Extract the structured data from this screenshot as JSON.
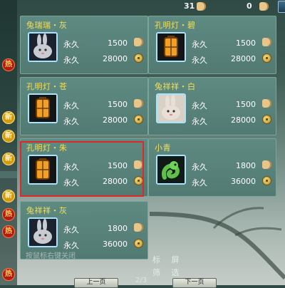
{
  "topbar": {
    "count_left": "31",
    "count_right": "0"
  },
  "sidebar_badges": [
    {
      "label": "热",
      "type": "hot"
    },
    {
      "label": "新",
      "type": "new"
    },
    {
      "label": "新",
      "type": "new"
    },
    {
      "label": "新",
      "type": "new"
    },
    {
      "label": "新",
      "type": "new"
    },
    {
      "label": "热",
      "type": "hot"
    },
    {
      "label": "热",
      "type": "hot"
    },
    {
      "label": "热",
      "type": "hot"
    }
  ],
  "items": [
    {
      "name": "兔瑞瑞・灰",
      "icon": "gray-rabbit-icon",
      "rows": [
        {
          "term": "永久",
          "price": "1500",
          "currency": "hand-icon"
        },
        {
          "term": "永久",
          "price": "28000",
          "currency": "coin-icon"
        }
      ]
    },
    {
      "name": "孔明灯・碧",
      "icon": "green-lantern-icon",
      "rows": [
        {
          "term": "永久",
          "price": "1500",
          "currency": "hand-icon"
        },
        {
          "term": "永久",
          "price": "28000",
          "currency": "coin-icon"
        }
      ]
    },
    {
      "name": "孔明灯・苍",
      "icon": "blue-lantern-icon",
      "rows": [
        {
          "term": "永久",
          "price": "1500",
          "currency": "hand-icon"
        },
        {
          "term": "永久",
          "price": "28000",
          "currency": "coin-icon"
        }
      ]
    },
    {
      "name": "兔祥祥・白",
      "icon": "white-rabbit-icon",
      "rows": [
        {
          "term": "永久",
          "price": "1500",
          "currency": "hand-icon"
        },
        {
          "term": "永久",
          "price": "28000",
          "currency": "coin-icon"
        }
      ]
    },
    {
      "name": "孔明灯・朱",
      "icon": "red-lantern-icon",
      "rows": [
        {
          "term": "永久",
          "price": "1500",
          "currency": "hand-icon"
        },
        {
          "term": "永久",
          "price": "28000",
          "currency": "coin-icon"
        }
      ]
    },
    {
      "name": "小青",
      "icon": "green-snake-icon",
      "rows": [
        {
          "term": "永久",
          "price": "1800",
          "currency": "hand-icon"
        },
        {
          "term": "永久",
          "price": "36000",
          "currency": "coin-icon"
        }
      ]
    },
    {
      "name": "兔祥祥・灰",
      "icon": "gray-rabbit-icon",
      "rows": [
        {
          "term": "永久",
          "price": "1800",
          "currency": "hand-icon"
        },
        {
          "term": "永久",
          "price": "36000",
          "currency": "coin-icon"
        }
      ]
    }
  ],
  "side_tabs": {
    "tab1": "标 屏",
    "tab2": "筛 选"
  },
  "pager": {
    "prev": "上一页",
    "next": "下一页",
    "page": "2/3"
  },
  "hint": "按鼠标右键关闭"
}
